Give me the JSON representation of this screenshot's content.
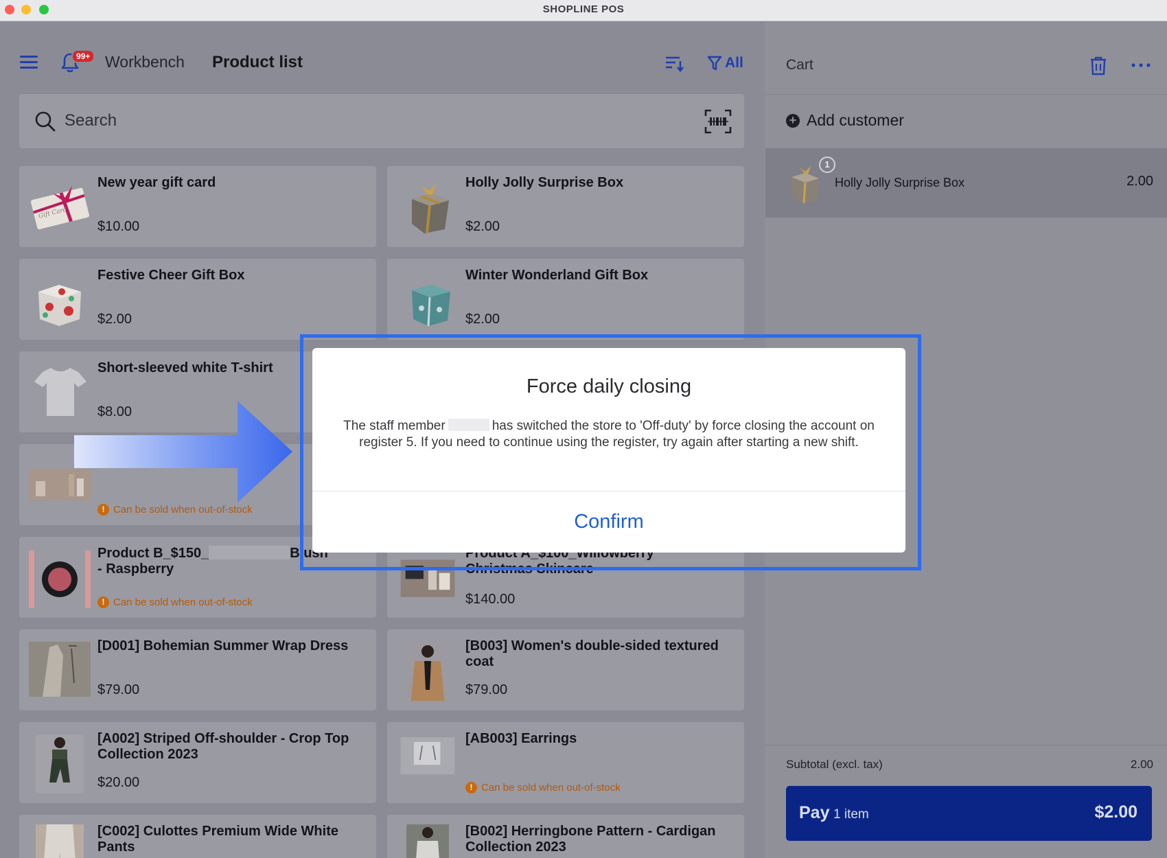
{
  "window": {
    "title": "SHOPLINE POS"
  },
  "header": {
    "notification_badge": "99+",
    "workbench_label": "Workbench",
    "page_title": "Product list",
    "filter_label": "All"
  },
  "search": {
    "placeholder": "Search"
  },
  "products": [
    {
      "name": "New year gift card",
      "price": "$10.00",
      "thumb": "gift-card"
    },
    {
      "name": "Holly Jolly Surprise Box",
      "price": "$2.00",
      "thumb": "gift-box-gold"
    },
    {
      "name": "Festive Cheer Gift Box",
      "price": "$2.00",
      "thumb": "gift-box-red"
    },
    {
      "name": "Winter Wonderland Gift Box",
      "price": "$2.00",
      "thumb": "gift-box-blue"
    },
    {
      "name": "Short-sleeved white T-shirt",
      "price": "$8.00",
      "thumb": "t-shirt"
    },
    {
      "name": "",
      "status": "Can be sold when out-of-stock",
      "thumb": "skincare-set"
    },
    {
      "name": "Product B_$150_",
      "name_tail": "Blush",
      "name_line2": "- Raspberry",
      "status": "Can be sold when out-of-stock",
      "thumb": "blush"
    },
    {
      "name": "Product A_$100_Willowberry",
      "name_line2": "Christmas Skincare",
      "price": "$140.00",
      "thumb": "skincare-box"
    },
    {
      "name": "[D001] Bohemian Summer Wrap Dress",
      "price": "$79.00",
      "thumb": "dress"
    },
    {
      "name": "[B003] Women's double-sided textured coat",
      "price": "$79.00",
      "thumb": "coat"
    },
    {
      "name": "[A002] Striped Off-shoulder - Crop Top Collection 2023",
      "price": "$20.00",
      "thumb": "crop-top"
    },
    {
      "name": "[AB003] Earrings",
      "status": "Can be sold when out-of-stock",
      "thumb": "earrings"
    },
    {
      "name": "[C002] Culottes Premium Wide White Pants",
      "thumb": "pants"
    },
    {
      "name": "[B002] Herringbone Pattern - Cardigan Collection 2023",
      "thumb": "cardigan"
    }
  ],
  "cart": {
    "title": "Cart",
    "add_customer_label": "Add customer",
    "line": {
      "name": "Holly Jolly Surprise Box",
      "qty": "1",
      "price": "2.00"
    },
    "subtotal_label": "Subtotal (excl. tax)",
    "subtotal_value": "2.00",
    "pay_label": "Pay",
    "pay_count": "1 item",
    "pay_amount": "$2.00"
  },
  "dialog": {
    "title": "Force daily closing",
    "message_part1": "The staff member",
    "message_part2": "has switched the store to 'Off-duty' by force closing the account on register 5. If you need to continue using the register, try again after starting a new shift.",
    "confirm_label": "Confirm"
  },
  "colors": {
    "accent": "#1f3fb0",
    "pay_button": "#0b2587",
    "highlight": "#2c6cf0",
    "warning": "#b75a07",
    "dialog_link": "#1f5fd6"
  }
}
